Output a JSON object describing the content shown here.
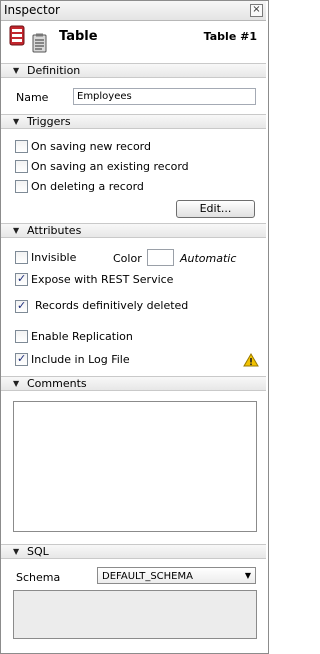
{
  "window": {
    "title": "Inspector"
  },
  "header": {
    "title": "Table",
    "number": "Table #1",
    "icon1": "table-icon",
    "icon2": "clipboard-icon"
  },
  "sections": {
    "definition": "Definition",
    "triggers": "Triggers",
    "attributes": "Attributes",
    "comments": "Comments",
    "sql": "SQL"
  },
  "definition": {
    "name_label": "Name",
    "name_value": "Employees"
  },
  "triggers": {
    "items": [
      {
        "label": "On saving new record",
        "checked": false
      },
      {
        "label": "On saving an existing record",
        "checked": false
      },
      {
        "label": "On deleting a record",
        "checked": false
      }
    ],
    "edit_button": "Edit..."
  },
  "attributes": {
    "invisible": {
      "label": "Invisible",
      "checked": false
    },
    "color_label": "Color",
    "color_value": "Automatic",
    "rest": {
      "label": "Expose with REST Service",
      "checked": true
    },
    "records_deleted": {
      "label": "Records definitively deleted",
      "checked": true
    },
    "replication": {
      "label": "Enable Replication",
      "checked": false
    },
    "log_file": {
      "label": "Include in Log File",
      "checked": true
    }
  },
  "comments": {
    "text": ""
  },
  "sql": {
    "schema_label": "Schema",
    "schema_value": "DEFAULT_SCHEMA"
  },
  "colors": {
    "warning": "#f2c200",
    "checkmark": "#1a2a7a"
  }
}
